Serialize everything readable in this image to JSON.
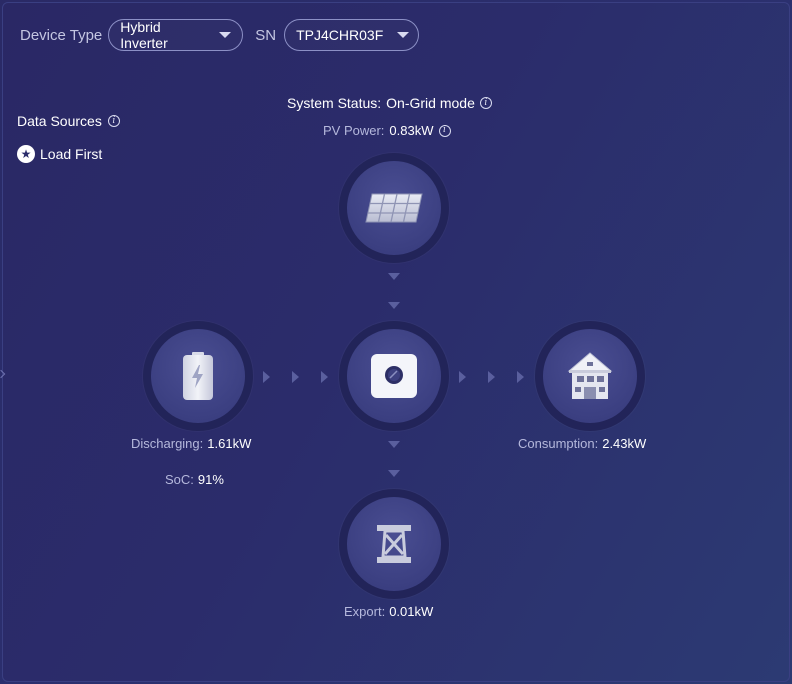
{
  "toolbar": {
    "device_type_label": "Device Type",
    "device_type_value": "Hybrid Inverter",
    "sn_label": "SN",
    "sn_value": "TPJ4CHR03F"
  },
  "data_sources": {
    "title": "Data Sources",
    "mode": "Load First"
  },
  "system_status": {
    "label": "System Status:",
    "value": "On-Grid mode"
  },
  "pv_power": {
    "label": "PV Power:",
    "value": "0.83kW"
  },
  "battery": {
    "label": "Discharging:",
    "value": "1.61kW",
    "soc_label": "SoC:",
    "soc_value": "91%"
  },
  "consumption": {
    "label": "Consumption:",
    "value": "2.43kW"
  },
  "grid": {
    "label": "Export:",
    "value": "0.01kW"
  },
  "icons": {
    "info": "info-icon",
    "star": "star-icon",
    "pv": "solar-panel-icon",
    "battery": "battery-icon",
    "inverter": "inverter-icon",
    "home": "house-icon",
    "grid": "grid-tower-icon"
  },
  "colors": {
    "background": "#2b2c6b",
    "node_ring": "#222459",
    "node_fill": "#3b3f81",
    "flow_arrow": "#5a5f9e",
    "value_text": "#ffffff"
  }
}
